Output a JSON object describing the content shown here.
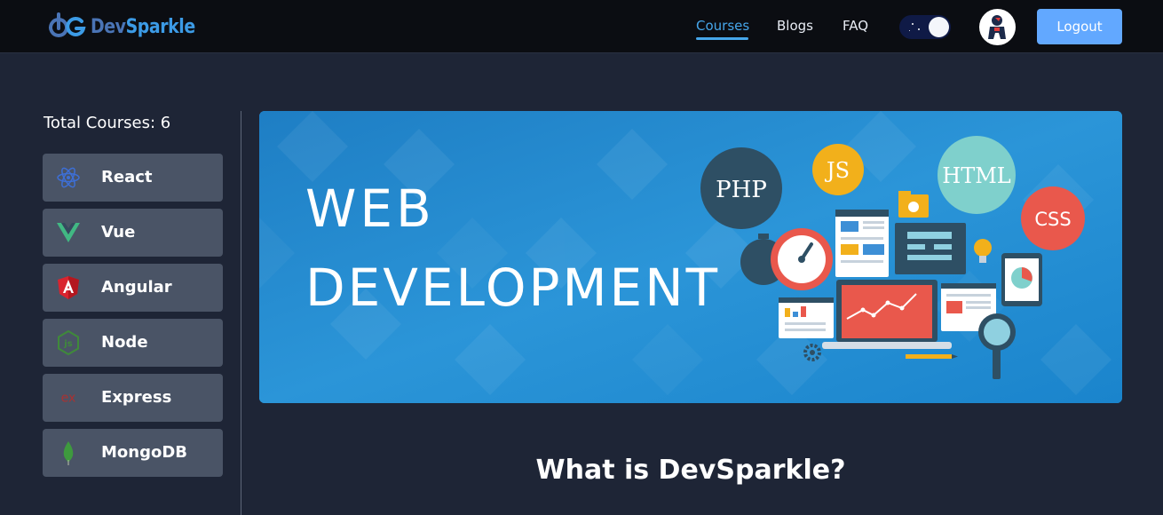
{
  "brand": {
    "part1": "Dev",
    "part2": "Sparkle"
  },
  "nav": {
    "links": [
      {
        "label": "Courses",
        "active": true
      },
      {
        "label": "Blogs"
      },
      {
        "label": "FAQ"
      }
    ],
    "logout_label": "Logout"
  },
  "sidebar": {
    "total_label": "Total Courses: 6",
    "courses": [
      {
        "label": "React",
        "icon": "react-icon",
        "color": "#3d6fd6"
      },
      {
        "label": "Vue",
        "icon": "vue-icon",
        "color": "#41b883"
      },
      {
        "label": "Angular",
        "icon": "angular-icon",
        "color": "#d9242f"
      },
      {
        "label": "Node",
        "icon": "node-icon",
        "color": "#3f8a3a"
      },
      {
        "label": "Express",
        "icon": "express-icon",
        "color": "#a83232"
      },
      {
        "label": "MongoDB",
        "icon": "mongodb-icon",
        "color": "#3e9a3e"
      }
    ]
  },
  "hero": {
    "line1": "WEB",
    "line2": "DEVELOPMENT",
    "bubbles": [
      "PHP",
      "JS",
      "HTML",
      "CSS"
    ]
  },
  "main": {
    "heading": "What is DevSparkle?"
  },
  "colors": {
    "accent": "#46a6ea",
    "button": "#62a8ff",
    "sidebar_item": "#4a5466",
    "background": "#1e2536"
  }
}
